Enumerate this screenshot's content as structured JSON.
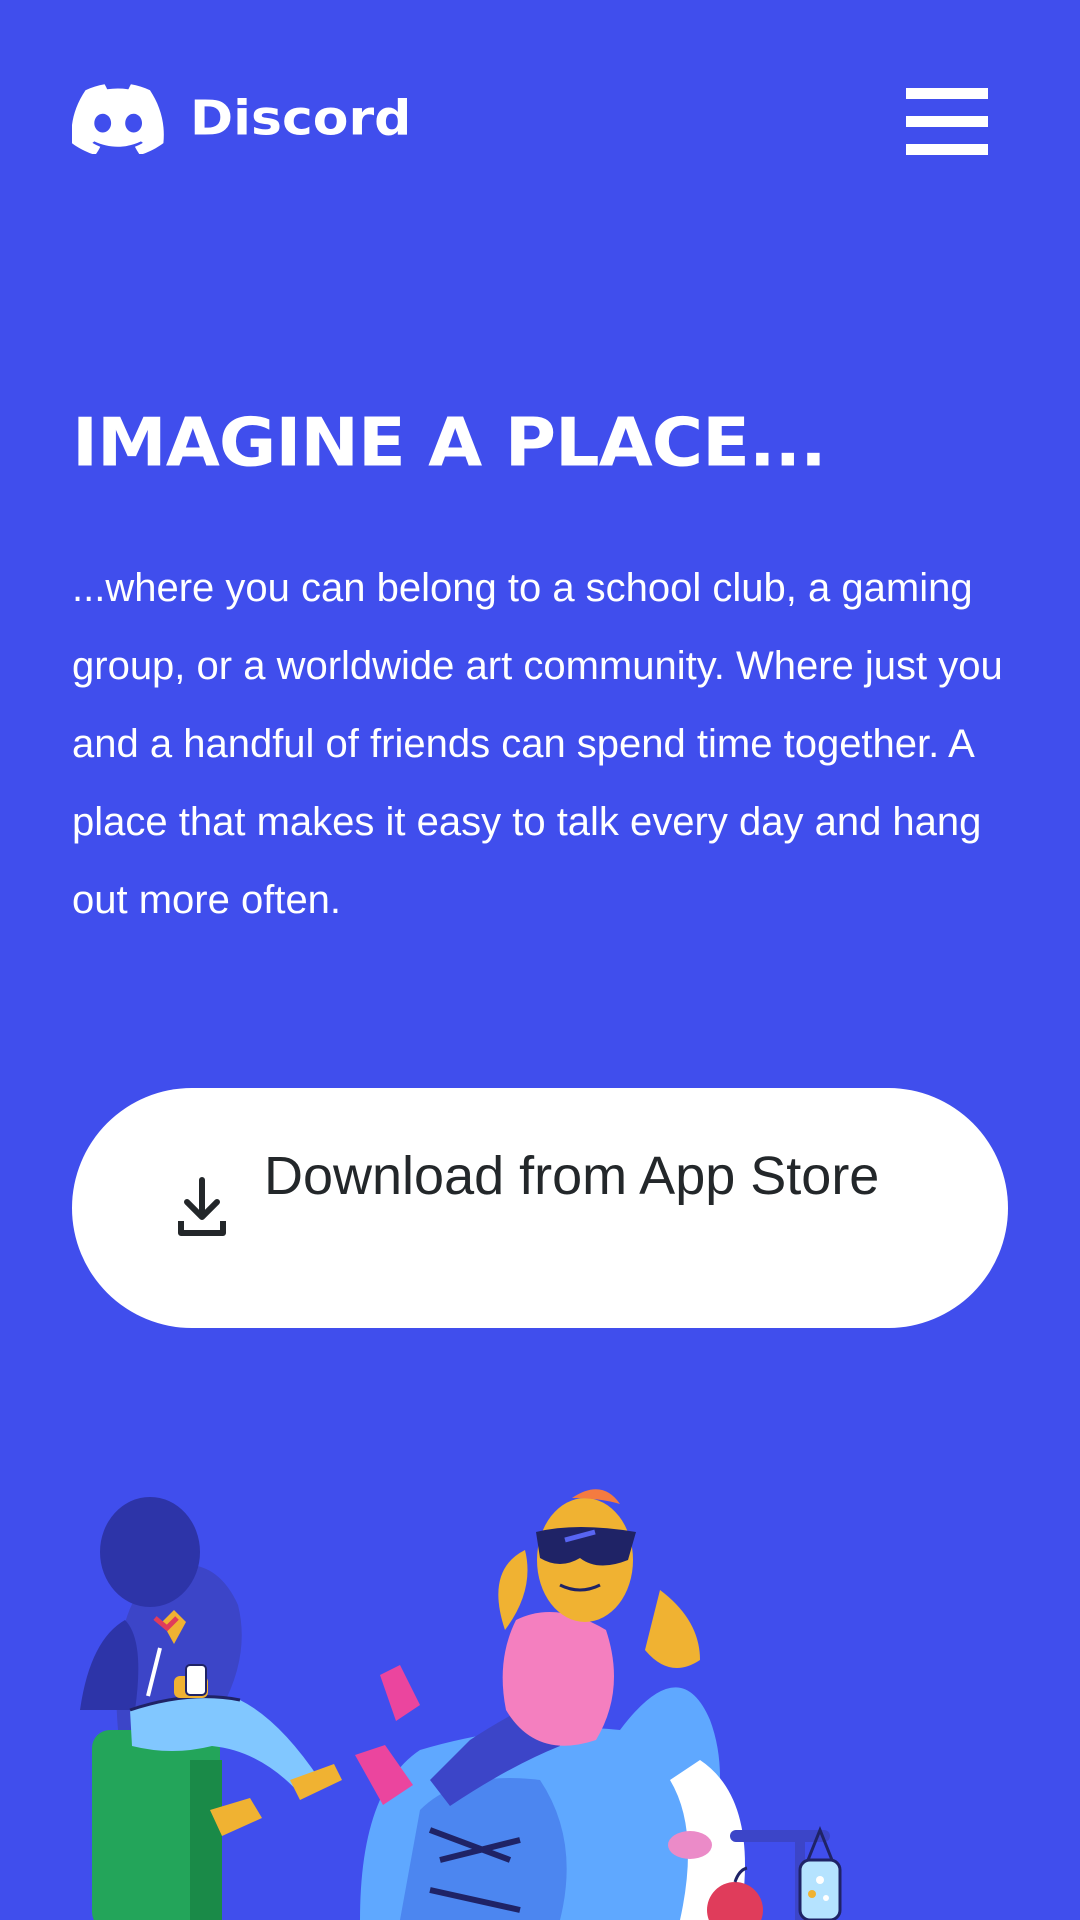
{
  "header": {
    "brand_name": "Discord",
    "logo_icon": "discord-logo-icon",
    "menu_icon": "hamburger-menu-icon"
  },
  "hero": {
    "title": "IMAGINE A PLACE...",
    "description": "...where you can belong to a school club, a gaming group, or a worldwide art community. Where just you and a handful of friends can spend time together. A place that makes it easy to talk every day and hang out more often.",
    "download_label": "Download from App Store",
    "download_icon": "download-icon"
  },
  "colors": {
    "background": "#404EED",
    "button_background": "#FFFFFF",
    "button_text": "#23272A",
    "text": "#FFFFFF"
  }
}
